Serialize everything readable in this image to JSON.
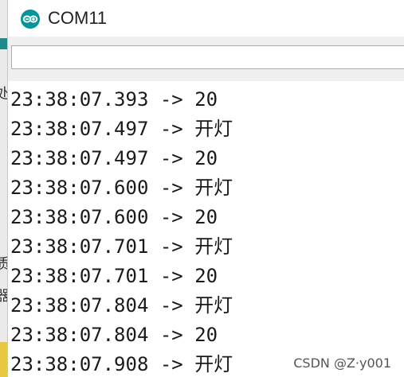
{
  "window": {
    "title": "COM11",
    "app_icon": "arduino-infinity-icon",
    "accent_color": "#00979c"
  },
  "send_field": {
    "value": "",
    "placeholder": ""
  },
  "background_window_fragments": [
    "处",
    "质",
    "器"
  ],
  "serial_output": {
    "lines": [
      "23:38:07.393 -> 20",
      "23:38:07.497 -> 开灯",
      "23:38:07.497 -> 20",
      "23:38:07.600 -> 开灯",
      "23:38:07.600 -> 20",
      "23:38:07.701 -> 开灯",
      "23:38:07.701 -> 20",
      "23:38:07.804 -> 开灯",
      "23:38:07.804 -> 20",
      "23:38:07.908 -> 开灯"
    ]
  },
  "watermark": "CSDN @Z·y001"
}
